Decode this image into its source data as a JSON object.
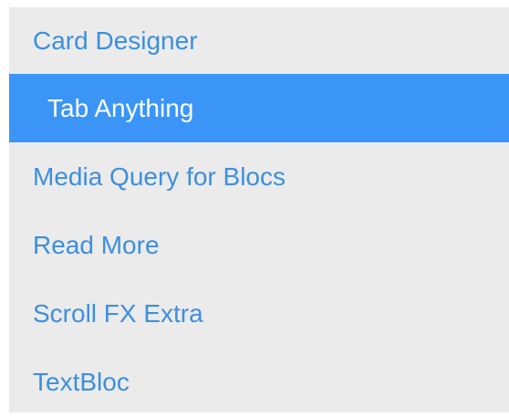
{
  "menu": {
    "items": [
      {
        "label": "Card Designer",
        "active": false
      },
      {
        "label": "Tab Anything",
        "active": true
      },
      {
        "label": "Media Query for Blocs",
        "active": false
      },
      {
        "label": "Read More",
        "active": false
      },
      {
        "label": "Scroll FX Extra",
        "active": false
      },
      {
        "label": "TextBloc",
        "active": false
      }
    ]
  },
  "colors": {
    "panel_background": "#ebebeb",
    "link": "#3d8fde",
    "active_background": "#3a95f7",
    "active_text": "#ffffff"
  }
}
